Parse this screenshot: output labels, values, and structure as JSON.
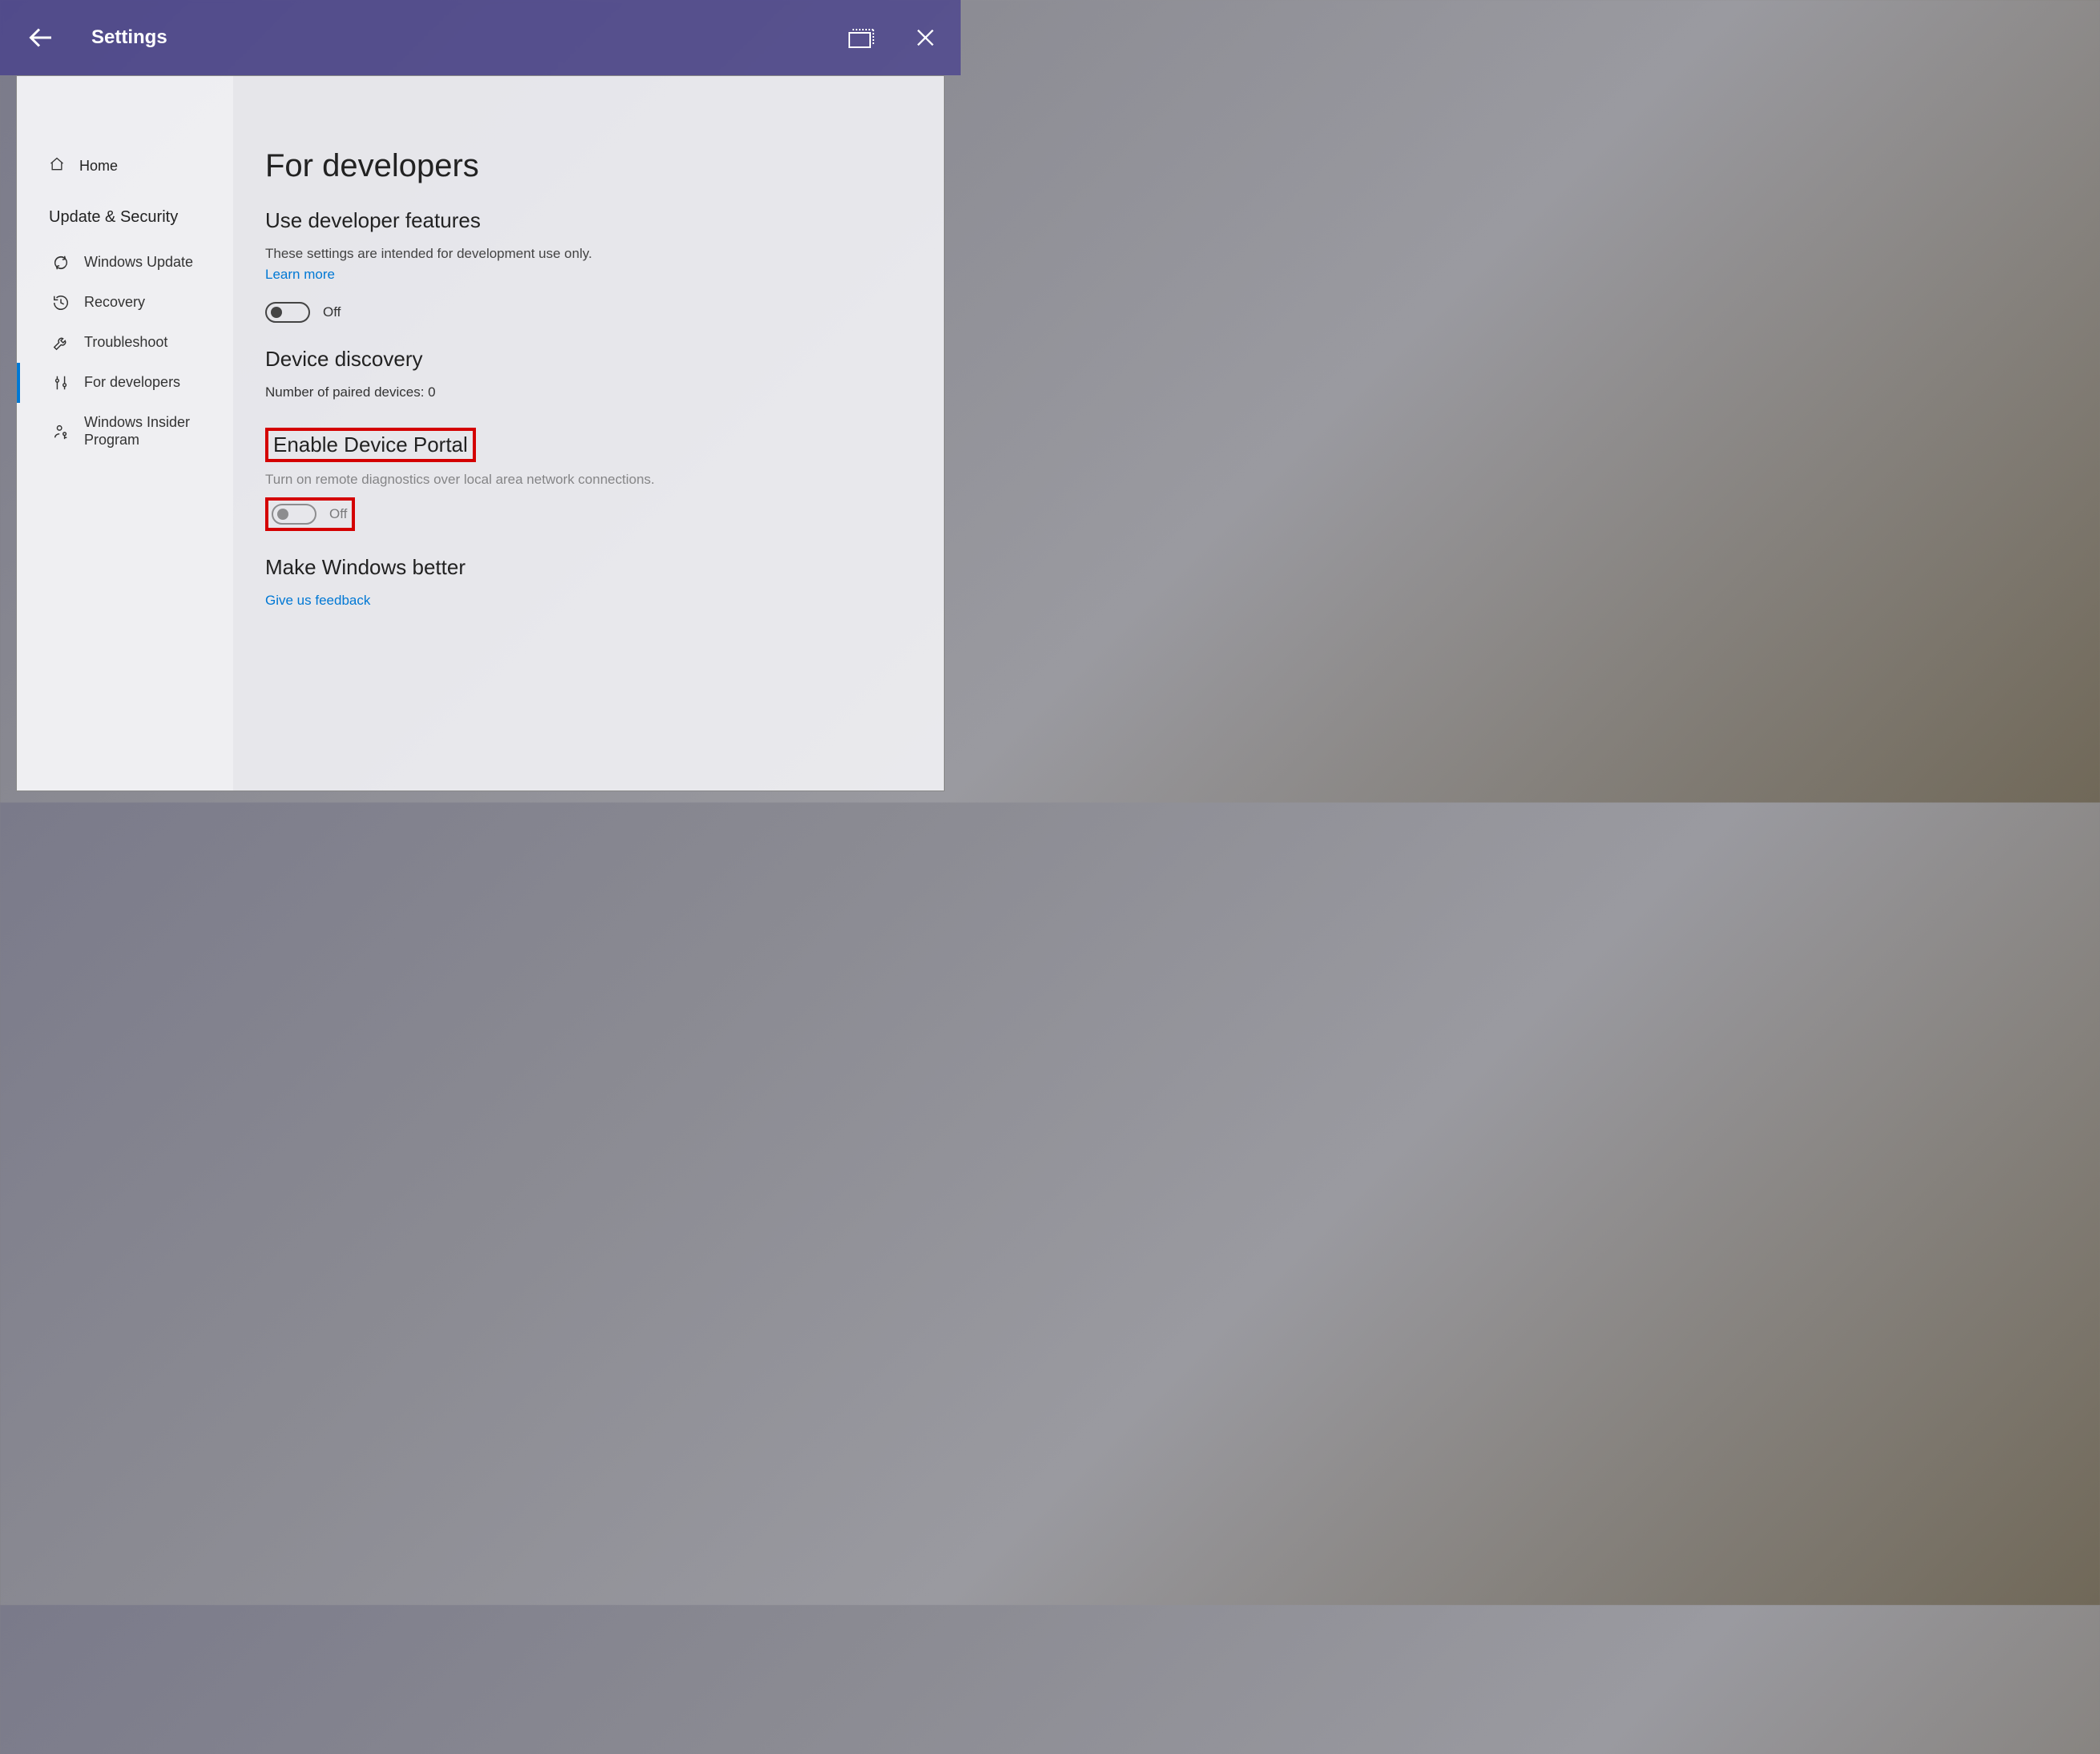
{
  "titlebar": {
    "title": "Settings"
  },
  "sidebar": {
    "home": "Home",
    "category": "Update & Security",
    "items": [
      {
        "label": "Windows Update",
        "icon": "refresh-icon"
      },
      {
        "label": "Recovery",
        "icon": "history-icon"
      },
      {
        "label": "Troubleshoot",
        "icon": "wrench-icon"
      },
      {
        "label": "For developers",
        "icon": "sliders-icon"
      },
      {
        "label": "Windows Insider Program",
        "icon": "person-key-icon"
      }
    ]
  },
  "content": {
    "heading": "For developers",
    "section1_title": "Use developer features",
    "section1_desc": "These settings are intended for development use only.",
    "learn_more": "Learn more",
    "toggle1_state": "Off",
    "section2_title": "Device discovery",
    "paired_label": "Number of paired devices: 0",
    "section3_title": "Enable Device Portal",
    "section3_desc": "Turn on remote diagnostics over local area network connections.",
    "toggle2_state": "Off",
    "section4_title": "Make Windows better",
    "feedback_link": "Give us feedback"
  }
}
